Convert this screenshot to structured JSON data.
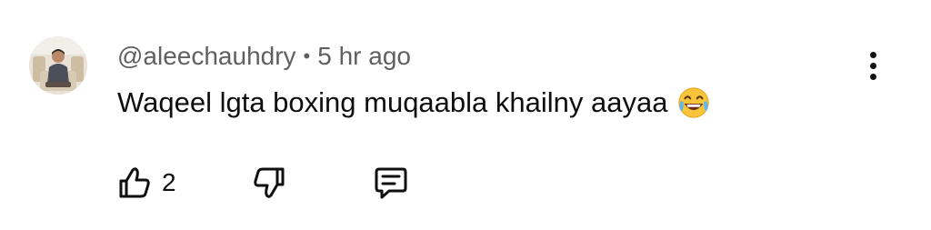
{
  "comment": {
    "author": "@aleechauhdry",
    "separator": "•",
    "time_ago": "5 hr ago",
    "text": "Waqeel lgta boxing muqaabla khailny aayaa",
    "emoji": "rolling-on-floor-laughing-emoji"
  },
  "actions": {
    "like_count": "2",
    "like_icon": "thumbs-up-outline-icon",
    "dislike_icon": "thumbs-down-outline-icon",
    "reply_icon": "comment-outline-icon",
    "more_icon": "three-dots-vertical-icon"
  },
  "colors": {
    "text_primary": "#0f0f0f",
    "text_secondary": "#606060",
    "background": "#ffffff"
  }
}
